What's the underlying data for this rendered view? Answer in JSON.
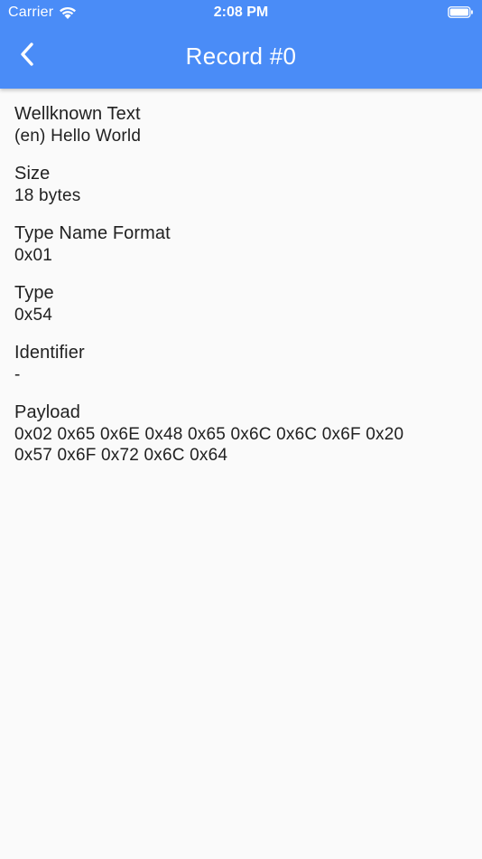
{
  "status_bar": {
    "carrier": "Carrier",
    "time": "2:08 PM",
    "wifi_icon": "wifi-icon",
    "battery_icon": "battery-full-icon"
  },
  "app_bar": {
    "title": "Record #0",
    "back_icon": "chevron-left-icon",
    "background_color": "#4a8cf7"
  },
  "fields": {
    "wellknown_text": {
      "label": "Wellknown Text",
      "value": "(en) Hello World"
    },
    "size": {
      "label": "Size",
      "value": "18 bytes"
    },
    "type_name_format": {
      "label": "Type Name Format",
      "value": "0x01"
    },
    "type": {
      "label": "Type",
      "value": "0x54"
    },
    "identifier": {
      "label": "Identifier",
      "value": "-"
    },
    "payload": {
      "label": "Payload",
      "value_line1": "0x02 0x65 0x6E 0x48 0x65 0x6C 0x6C 0x6F 0x20",
      "value_line2": "0x57 0x6F 0x72 0x6C 0x64"
    }
  }
}
